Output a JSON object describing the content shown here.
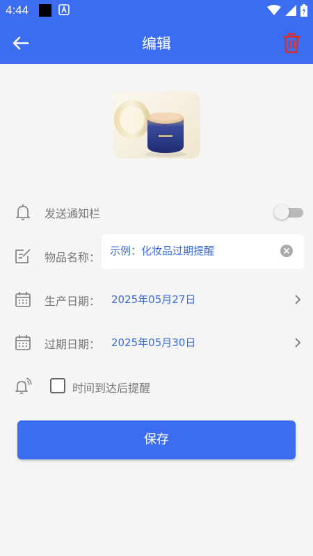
{
  "status_bar": {
    "time": "4:44",
    "left_icons": [
      "black-square-icon",
      "text-a-icon"
    ],
    "right_icons": [
      "wifi-icon",
      "cellular-signal-icon",
      "battery-charging-icon"
    ]
  },
  "app_bar": {
    "title": "编辑",
    "back_icon": "arrow-left-icon",
    "delete_icon": "trash-icon",
    "color": "#3c6cf0",
    "delete_color": "#d32f2f"
  },
  "product": {
    "image_icon": "cosmetic-cream-jar-image"
  },
  "form": {
    "notify": {
      "label": "发送通知栏",
      "icon": "bell-icon",
      "enabled": false
    },
    "item_name": {
      "label": "物品名称：",
      "icon": "edit-note-icon",
      "value": "",
      "placeholder": "示例：化妆品过期提醒"
    },
    "production_date": {
      "label": "生产日期：",
      "icon": "calendar-icon",
      "value": "2025年05月27日"
    },
    "expiry_date": {
      "label": "过期日期：",
      "icon": "calendar-icon",
      "value": "2025年05月30日"
    },
    "remind_on_time": {
      "label": "时间到达后提醒",
      "icon": "alarm-bell-icon",
      "checked": false
    }
  },
  "save_button": {
    "label": "保存"
  },
  "colors": {
    "accent": "#3c6cf0",
    "value_text": "#3a6ae0",
    "label_text": "#777777",
    "background": "#f5f5f5"
  }
}
